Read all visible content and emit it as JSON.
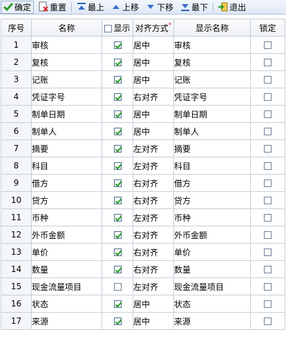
{
  "toolbar": {
    "confirm": {
      "label": "确定",
      "icon": "check-icon"
    },
    "reset": {
      "label": "重置",
      "icon": "reset-icon"
    },
    "top": {
      "label": "最上",
      "icon": "move-top-icon"
    },
    "up": {
      "label": "上移",
      "icon": "move-up-icon"
    },
    "down": {
      "label": "下移",
      "icon": "move-down-icon"
    },
    "bottom": {
      "label": "最下",
      "icon": "move-bottom-icon"
    },
    "exit": {
      "label": "退出",
      "icon": "exit-icon"
    }
  },
  "grid": {
    "headers": {
      "seq": "序号",
      "name": "名称",
      "show": "显示",
      "align": "对齐方式",
      "align_required": "*",
      "display_name": "显示名称",
      "lock": "锁定"
    },
    "header_show_checked": false,
    "rows": [
      {
        "seq": "1",
        "name": "审核",
        "show": true,
        "align": "居中",
        "display_name": "审核",
        "lock": false
      },
      {
        "seq": "2",
        "name": "复核",
        "show": true,
        "align": "居中",
        "display_name": "复核",
        "lock": false
      },
      {
        "seq": "3",
        "name": "记账",
        "show": true,
        "align": "居中",
        "display_name": "记账",
        "lock": false
      },
      {
        "seq": "4",
        "name": "凭证字号",
        "show": true,
        "align": "右对齐",
        "display_name": "凭证字号",
        "lock": false
      },
      {
        "seq": "5",
        "name": "制单日期",
        "show": true,
        "align": "居中",
        "display_name": "制单日期",
        "lock": false
      },
      {
        "seq": "6",
        "name": "制单人",
        "show": true,
        "align": "居中",
        "display_name": "制单人",
        "lock": false
      },
      {
        "seq": "7",
        "name": "摘要",
        "show": true,
        "align": "左对齐",
        "display_name": "摘要",
        "lock": false
      },
      {
        "seq": "8",
        "name": "科目",
        "show": true,
        "align": "左对齐",
        "display_name": "科目",
        "lock": false
      },
      {
        "seq": "9",
        "name": "借方",
        "show": true,
        "align": "右对齐",
        "display_name": "借方",
        "lock": false
      },
      {
        "seq": "10",
        "name": "贷方",
        "show": true,
        "align": "右对齐",
        "display_name": "贷方",
        "lock": false
      },
      {
        "seq": "11",
        "name": "币种",
        "show": true,
        "align": "左对齐",
        "display_name": "币种",
        "lock": false
      },
      {
        "seq": "12",
        "name": "外币金额",
        "show": true,
        "align": "右对齐",
        "display_name": "外币金额",
        "lock": false
      },
      {
        "seq": "13",
        "name": "单价",
        "show": true,
        "align": "右对齐",
        "display_name": "单价",
        "lock": false
      },
      {
        "seq": "14",
        "name": "数量",
        "show": true,
        "align": "右对齐",
        "display_name": "数量",
        "lock": false
      },
      {
        "seq": "15",
        "name": "现金流量项目",
        "show": false,
        "align": "左对齐",
        "display_name": "现金流量项目",
        "lock": false
      },
      {
        "seq": "16",
        "name": "状态",
        "show": true,
        "align": "居中",
        "display_name": "状态",
        "lock": false
      },
      {
        "seq": "17",
        "name": "来源",
        "show": true,
        "align": "居中",
        "display_name": "来源",
        "lock": false
      }
    ]
  },
  "colors": {
    "check": "#1f9a1f",
    "toolbar_top": "#f3f7fd",
    "toolbar_bottom": "#dfe8f6",
    "grid_line": "#c7cfd9"
  }
}
